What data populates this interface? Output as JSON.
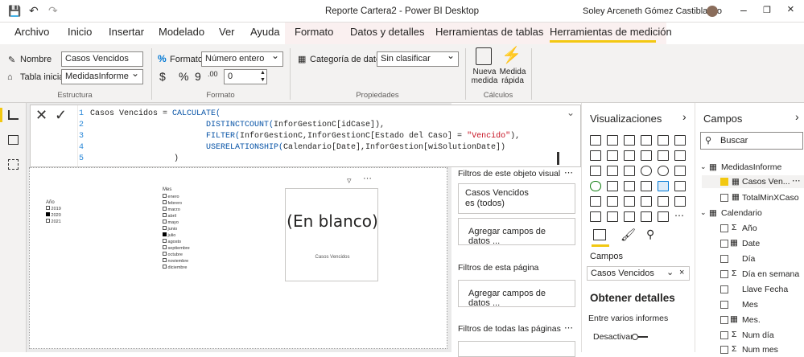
{
  "window": {
    "title": "Reporte Cartera2 - Power BI Desktop",
    "user": "Soley Arceneth Gómez Castiblanco"
  },
  "menu": {
    "items": [
      "Archivo",
      "Inicio",
      "Insertar",
      "Modelado",
      "Ver",
      "Ayuda"
    ],
    "context_items": [
      "Formato",
      "Datos y detalles",
      "Herramientas de tablas",
      "Herramientas de medición"
    ]
  },
  "ribbon": {
    "nombre_label": "Nombre",
    "nombre_value": "Casos Vencidos",
    "tabla_label": "Tabla inicial",
    "tabla_value": "MedidasInforme",
    "estructura": "Estructura",
    "formato_label": "Formato",
    "formato_value": "Número entero",
    "currency": "$",
    "percent": "%",
    "comma": "9",
    "decimals_value": "0",
    "formato_group": "Formato",
    "categoria_label": "Categoría de datos",
    "categoria_value": "Sin clasificar",
    "propiedades": "Propiedades",
    "nueva_medida": "Nueva medida",
    "medida_rapida": "Medida rápida",
    "calculos": "Cálculos"
  },
  "formula": {
    "line_numbers": [
      "1",
      "2",
      "3",
      "4",
      "5"
    ],
    "l1_a": "Casos Vencidos = ",
    "l1_b": "CALCULATE(",
    "l2_a": "DISTINCTCOUNT(",
    "l2_b": "InforGestionC[idCase]),",
    "l3_a": "FILTER(",
    "l3_b": "InforGestionC,InforGestionC[Estado del Caso] = ",
    "l3_c": "\"Vencido\"",
    "l3_d": "),",
    "l4_a": "USERELATIONSHIP(",
    "l4_b": "Calendario[Date],InforGestion[wiSolutionDate])",
    "l5": ")"
  },
  "canvas": {
    "anio_title": "Año",
    "anios": [
      "2019",
      "2020",
      "2021"
    ],
    "mes_title": "Mes",
    "meses": [
      "enero",
      "febrero",
      "marzo",
      "abril",
      "mayo",
      "junio",
      "julio",
      "agosto",
      "septiembre",
      "octubre",
      "noviembre",
      "diciembre"
    ],
    "card_value": "(En blanco)",
    "card_label": "Casos Vencidos"
  },
  "filters": {
    "visual_title": "Filtros de este objeto visual",
    "card_title": "Casos Vencidos",
    "card_sub": "es (todos)",
    "add1": "Agregar campos de datos ...",
    "page_title": "Filtros de esta página",
    "add2": "Agregar campos de datos ...",
    "all_title": "Filtros de todas las páginas"
  },
  "viz": {
    "title": "Visualizaciones",
    "campos_label": "Campos",
    "well_value": "Casos Vencidos",
    "obtener": "Obtener detalles",
    "entre": "Entre varios informes",
    "desactivar": "Desactivar"
  },
  "fields": {
    "title": "Campos",
    "search_placeholder": "Buscar",
    "tables": [
      {
        "name": "MedidasInforme",
        "items": [
          "Casos Ven...",
          "TotalMinXCaso"
        ]
      },
      {
        "name": "Calendario",
        "items": [
          "Año",
          "Date",
          "Día",
          "Día en semana",
          "Llave Fecha",
          "Mes",
          "Mes.",
          "Num día",
          "Num mes"
        ]
      }
    ]
  }
}
